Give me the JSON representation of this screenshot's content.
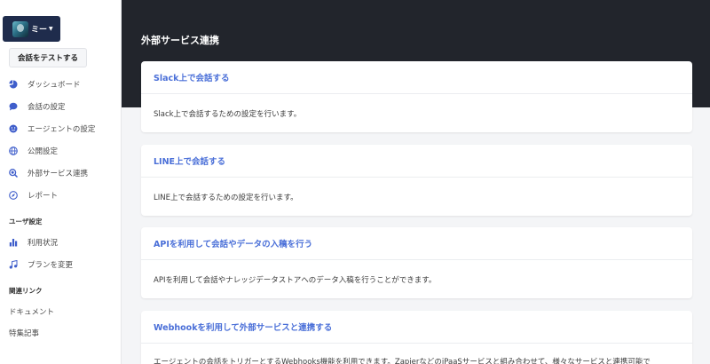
{
  "sidebar": {
    "user_name": "ミー",
    "test_button": "会話をテストする",
    "nav": [
      {
        "label": "ダッシュボード",
        "icon": "pie-chart-icon"
      },
      {
        "label": "会話の設定",
        "icon": "chat-bubble-icon"
      },
      {
        "label": "エージェントの設定",
        "icon": "smiley-icon"
      },
      {
        "label": "公開設定",
        "icon": "globe-icon"
      },
      {
        "label": "外部サービス連携",
        "icon": "link-search-icon"
      },
      {
        "label": "レポート",
        "icon": "compass-icon"
      }
    ],
    "user_section": "ユーザ設定",
    "user_nav": [
      {
        "label": "利用状況",
        "icon": "bar-chart-icon"
      },
      {
        "label": "プランを変更",
        "icon": "music-note-icon"
      }
    ],
    "links_section": "関連リンク",
    "links": [
      {
        "label": "ドキュメント"
      },
      {
        "label": "特集記事"
      }
    ]
  },
  "main": {
    "title": "外部サービス連携",
    "cards": [
      {
        "title": "Slack上で会話する",
        "desc": "Slack上で会話するための設定を行います。"
      },
      {
        "title": "LINE上で会話する",
        "desc": "LINE上で会話するための設定を行います。"
      },
      {
        "title": "APIを利用して会話やデータの入稿を行う",
        "desc": "APIを利用して会話やナレッジデータストアへのデータ入稿を行うことができます。"
      },
      {
        "title": "Webhookを利用して外部サービスと連携する",
        "desc": "エージェントの会話をトリガーとするWebhooks機能を利用できます。ZapierなどのiPaaSサービスと組み合わせて、様々なサービスと連携可能で"
      }
    ]
  },
  "colors": {
    "accent": "#4a6fd8",
    "header_bg": "#22252c",
    "user_button_bg": "#1f2c4c",
    "icon_color": "#3f5ecb"
  }
}
